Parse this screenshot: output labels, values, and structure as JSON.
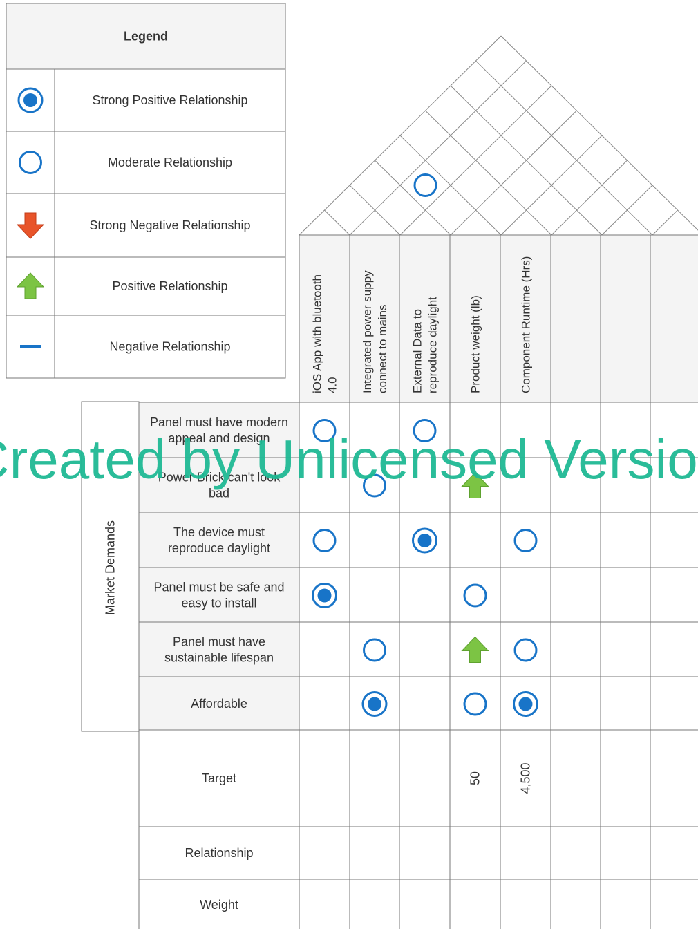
{
  "legend": {
    "title": "Legend",
    "items": [
      {
        "symbol": "strong-positive",
        "label": "Strong Positive Relationship"
      },
      {
        "symbol": "moderate",
        "label": "Moderate Relationship"
      },
      {
        "symbol": "strong-negative",
        "label": "Strong Negative Relationship"
      },
      {
        "symbol": "positive",
        "label": "Positive Relationship"
      },
      {
        "symbol": "negative",
        "label": "Negative Relationship"
      }
    ]
  },
  "section_label": "Market Demands",
  "columns": [
    {
      "lines": [
        "iOS App with bluetooth",
        "4.0"
      ]
    },
    {
      "lines": [
        "Integrated power suppy",
        "connect to mains"
      ]
    },
    {
      "lines": [
        "External Data to",
        "reproduce daylight"
      ]
    },
    {
      "lines": [
        "Product weight (lb)"
      ]
    },
    {
      "lines": [
        "Component Runtime (Hrs)"
      ]
    },
    {
      "lines": []
    },
    {
      "lines": []
    },
    {
      "lines": []
    }
  ],
  "rows": [
    {
      "lines": [
        "Panel must have modern",
        "appeal and design"
      ],
      "cells": [
        "moderate",
        "",
        "moderate",
        "",
        "",
        "",
        "",
        ""
      ]
    },
    {
      "lines": [
        "Power Brick can't look",
        "bad"
      ],
      "cells": [
        "",
        "moderate",
        "",
        "positive",
        "",
        "",
        "",
        ""
      ]
    },
    {
      "lines": [
        "The device must",
        "reproduce daylight"
      ],
      "cells": [
        "moderate",
        "",
        "strong-positive",
        "",
        "moderate",
        "",
        "",
        ""
      ]
    },
    {
      "lines": [
        "Panel must be safe and",
        "easy to install"
      ],
      "cells": [
        "strong-positive",
        "",
        "",
        "moderate",
        "",
        "",
        "",
        ""
      ]
    },
    {
      "lines": [
        "Panel must have",
        "sustainable lifespan"
      ],
      "cells": [
        "",
        "moderate",
        "",
        "positive",
        "moderate",
        "",
        "",
        ""
      ]
    },
    {
      "lines": [
        "Affordable"
      ],
      "cells": [
        "",
        "strong-positive",
        "",
        "moderate",
        "strong-positive",
        "",
        "",
        ""
      ]
    }
  ],
  "target": {
    "label": "Target",
    "values": [
      "",
      "",
      "",
      "50",
      "4,500",
      "",
      "",
      ""
    ]
  },
  "relationship_row": {
    "label": "Relationship"
  },
  "weight_row": {
    "label": "Weight"
  },
  "roof_marks": [
    {
      "col_a": 1,
      "col_b": 3,
      "symbol": "moderate"
    }
  ],
  "watermark": "Created by Unlicensed Version",
  "colors": {
    "symbol_blue": "#1874c8",
    "arrow_green": "#7cc444",
    "arrow_red": "#e8542a",
    "watermark": "#1fb894",
    "grid": "#777777",
    "header_fill": "#f4f4f4"
  }
}
